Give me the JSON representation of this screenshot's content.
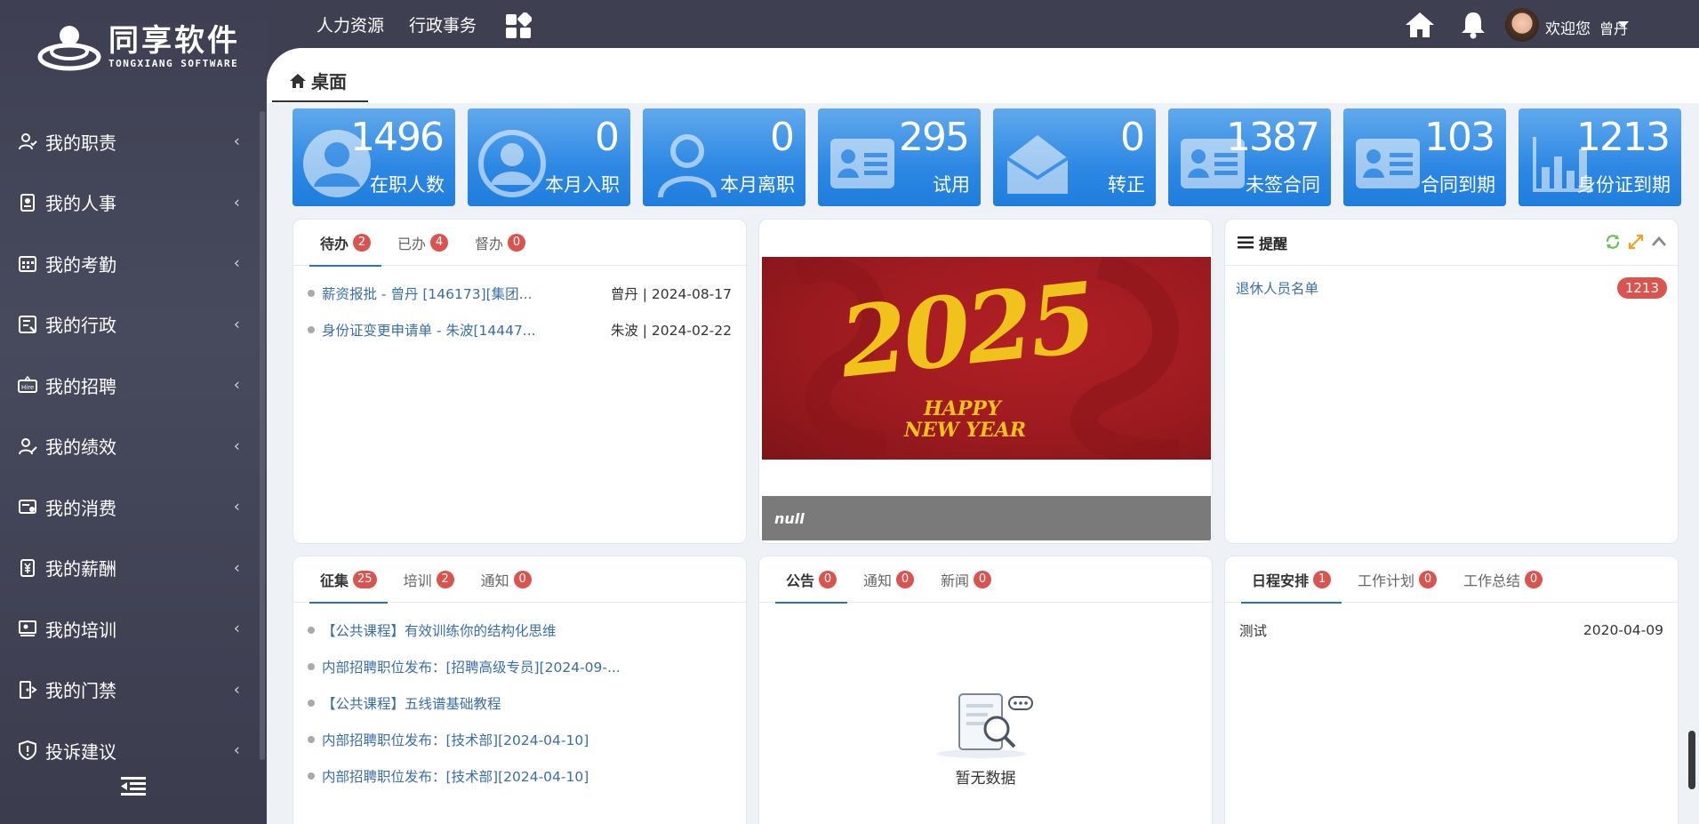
{
  "brand": {
    "name_cn": "同享软件",
    "name_en": "TONGXIANG SOFTWARE"
  },
  "sidebar": {
    "items": [
      {
        "label": "我的职责",
        "icon": "user-duty-icon"
      },
      {
        "label": "我的人事",
        "icon": "personnel-icon"
      },
      {
        "label": "我的考勤",
        "icon": "calendar-icon"
      },
      {
        "label": "我的行政",
        "icon": "admin-icon"
      },
      {
        "label": "我的招聘",
        "icon": "recruit-icon"
      },
      {
        "label": "我的绩效",
        "icon": "performance-icon"
      },
      {
        "label": "我的消费",
        "icon": "consume-icon"
      },
      {
        "label": "我的薪酬",
        "icon": "salary-icon"
      },
      {
        "label": "我的培训",
        "icon": "training-icon"
      },
      {
        "label": "我的门禁",
        "icon": "access-icon"
      },
      {
        "label": "投诉建议",
        "icon": "complaint-icon"
      }
    ]
  },
  "topbar": {
    "links": [
      "人力资源",
      "行政事务"
    ],
    "welcome": "欢迎您",
    "user": "曾丹"
  },
  "page_tab": {
    "label": "桌面"
  },
  "stats": [
    {
      "value": "1496",
      "label": "在职人数",
      "icon": "person-icon"
    },
    {
      "value": "0",
      "label": "本月入职",
      "icon": "person-circle-icon"
    },
    {
      "value": "0",
      "label": "本月离职",
      "icon": "person-outline-icon"
    },
    {
      "value": "295",
      "label": "试用",
      "icon": "id-card-icon"
    },
    {
      "value": "0",
      "label": "转正",
      "icon": "envelope-open-icon"
    },
    {
      "value": "1387",
      "label": "未签合同",
      "icon": "id-card-icon"
    },
    {
      "value": "103",
      "label": "合同到期",
      "icon": "id-card-icon"
    },
    {
      "value": "1213",
      "label": "身份证到期",
      "icon": "bar-chart-icon"
    }
  ],
  "todo_panel": {
    "tabs": [
      {
        "label": "待办",
        "count": "2"
      },
      {
        "label": "已办",
        "count": "4"
      },
      {
        "label": "督办",
        "count": "0"
      }
    ],
    "items": [
      {
        "title": "薪资报批 - 曾丹 [146173][集团...",
        "meta": "曾丹 | 2024-08-17"
      },
      {
        "title": "身份证变更申请单 - 朱波[14447...",
        "meta": "朱波 | 2024-02-22"
      }
    ]
  },
  "banner": {
    "headline": "2025",
    "sub1": "HAPPY",
    "sub2": "NEW YEAR",
    "caption": "null"
  },
  "remind_panel": {
    "title": "提醒",
    "items": [
      {
        "label": "退休人员名单",
        "count": "1213"
      }
    ]
  },
  "collect_panel": {
    "tabs": [
      {
        "label": "征集",
        "count": "25"
      },
      {
        "label": "培训",
        "count": "2"
      },
      {
        "label": "通知",
        "count": "0"
      }
    ],
    "items": [
      "【公共课程】有效训练你的结构化思维",
      "内部招聘职位发布：[招聘高级专员][2024-09-...",
      "【公共课程】五线谱基础教程",
      "内部招聘职位发布：[技术部][2024-04-10]",
      "内部招聘职位发布：[技术部][2024-04-10]"
    ]
  },
  "notice_panel": {
    "tabs": [
      {
        "label": "公告",
        "count": "0"
      },
      {
        "label": "通知",
        "count": "0"
      },
      {
        "label": "新闻",
        "count": "0"
      }
    ],
    "empty_text": "暂无数据"
  },
  "schedule_panel": {
    "tabs": [
      {
        "label": "日程安排",
        "count": "1"
      },
      {
        "label": "工作计划",
        "count": "0"
      },
      {
        "label": "工作总结",
        "count": "0"
      }
    ],
    "items": [
      {
        "title": "测试",
        "date": "2020-04-09"
      }
    ]
  },
  "colors": {
    "sidebar_bg": "#3f3f52",
    "card_blue": "#2d88e4",
    "badge_red": "#d9534f",
    "link_blue": "#3a6ea8"
  }
}
